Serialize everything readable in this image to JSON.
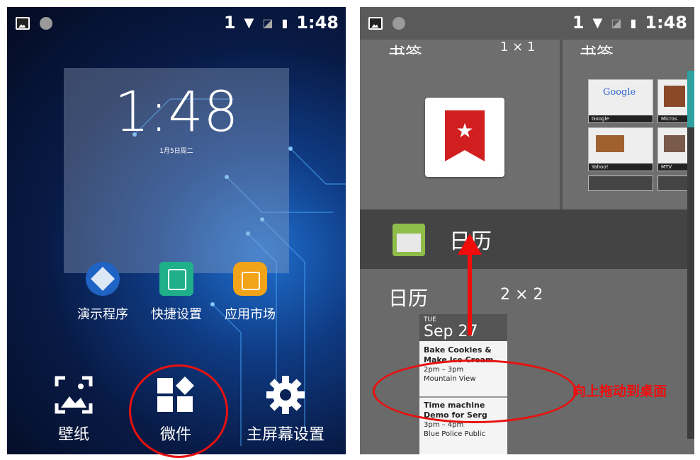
{
  "left_screen": {
    "status": {
      "sim": "1",
      "time": "1:48"
    },
    "clock": {
      "time": "1:48",
      "date": "1月5日周二"
    },
    "apps": [
      {
        "label": "演示程序",
        "color": "#1f63c4"
      },
      {
        "label": "快捷设置",
        "color": "#1fb08a"
      },
      {
        "label": "应用市场",
        "color": "#f2a317"
      }
    ],
    "bottom": [
      {
        "label": "壁纸",
        "icon": "wallpaper-icon"
      },
      {
        "label": "微件",
        "icon": "widgets-icon"
      },
      {
        "label": "主屏幕设置",
        "icon": "gear-icon"
      }
    ]
  },
  "right_screen": {
    "status": {
      "sim": "1",
      "time": "1:48"
    },
    "top_partial_labels": [
      "书签",
      "1 × 1",
      "书签"
    ],
    "thumb_captions": [
      "Google",
      "Micros",
      "Yahoo!",
      "MTV"
    ],
    "calendar_header": "日历",
    "widget": {
      "name": "日历",
      "size": "2 × 2"
    },
    "calendar_preview": {
      "dow": "TUE",
      "date": "Sep 27",
      "events": [
        {
          "title": "Bake Cookies &",
          "title2": "Make Ice Cream",
          "time": "2pm – 3pm",
          "place": "Mountain View"
        },
        {
          "title": "Time machine",
          "title2": "Demo for Serg",
          "time": "3pm – 4pm",
          "place": "Blue Police Public"
        }
      ]
    }
  },
  "annotation": {
    "text": "向上拖动到桌面",
    "color": "#f10c0c"
  }
}
